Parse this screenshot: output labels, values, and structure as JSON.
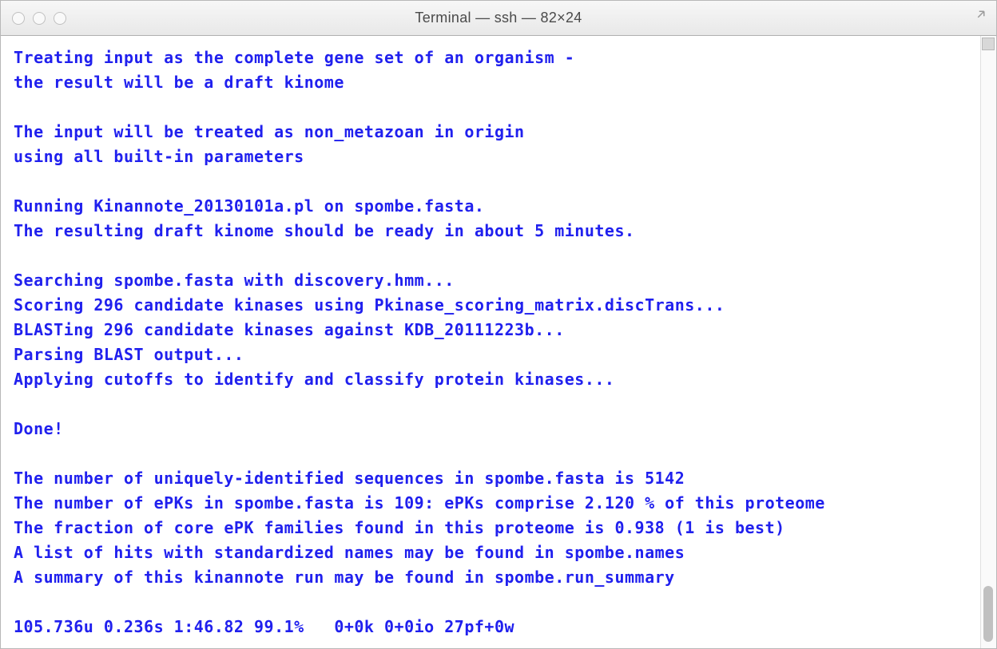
{
  "window": {
    "title": "Terminal — ssh — 82×24"
  },
  "terminal": {
    "lines": [
      "Treating input as the complete gene set of an organism -",
      "the result will be a draft kinome",
      "",
      "The input will be treated as non_metazoan in origin",
      "using all built-in parameters",
      "",
      "Running Kinannote_20130101a.pl on spombe.fasta.",
      "The resulting draft kinome should be ready in about 5 minutes.",
      "",
      "Searching spombe.fasta with discovery.hmm...",
      "Scoring 296 candidate kinases using Pkinase_scoring_matrix.discTrans...",
      "BLASTing 296 candidate kinases against KDB_20111223b...",
      "Parsing BLAST output...",
      "Applying cutoffs to identify and classify protein kinases...",
      "",
      "Done!",
      "",
      "The number of uniquely-identified sequences in spombe.fasta is 5142",
      "The number of ePKs in spombe.fasta is 109: ePKs comprise 2.120 % of this proteome",
      "The fraction of core ePK families found in this proteome is 0.938 (1 is best)",
      "A list of hits with standardized names may be found in spombe.names",
      "A summary of this kinannote run may be found in spombe.run_summary",
      "",
      "105.736u 0.236s 1:46.82 99.1%   0+0k 0+0io 27pf+0w"
    ]
  }
}
